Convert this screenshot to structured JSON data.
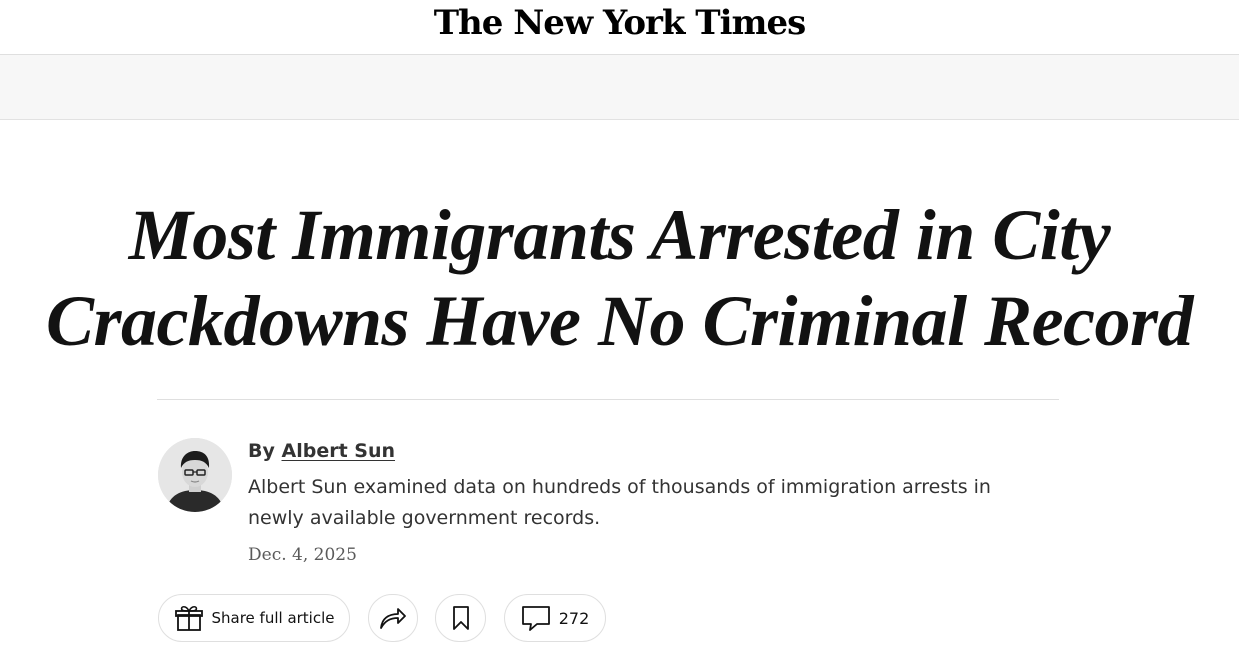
{
  "masthead": {
    "logo_text": "The New York Times"
  },
  "article": {
    "headline_line1": "Most Immigrants Arrested in City",
    "headline_line2": "Crackdowns Have No Criminal Record",
    "byline_prefix": "By",
    "author": "Albert Sun",
    "summary": "Albert Sun examined data on hundreds of thousands of immigration arrests in newly available government records.",
    "date": "Dec. 4, 2025"
  },
  "tools": {
    "share_label": "Share full article",
    "share_icon": "gift-icon",
    "forward_icon": "share-arrow-icon",
    "save_icon": "bookmark-icon",
    "comments_icon": "comment-icon",
    "comments_count": "272"
  },
  "colors": {
    "text": "#121212",
    "secondary_text": "#333333",
    "date_text": "#5a5a5a",
    "divider": "#dfdfdf",
    "ad_bar": "#f7f7f7"
  }
}
